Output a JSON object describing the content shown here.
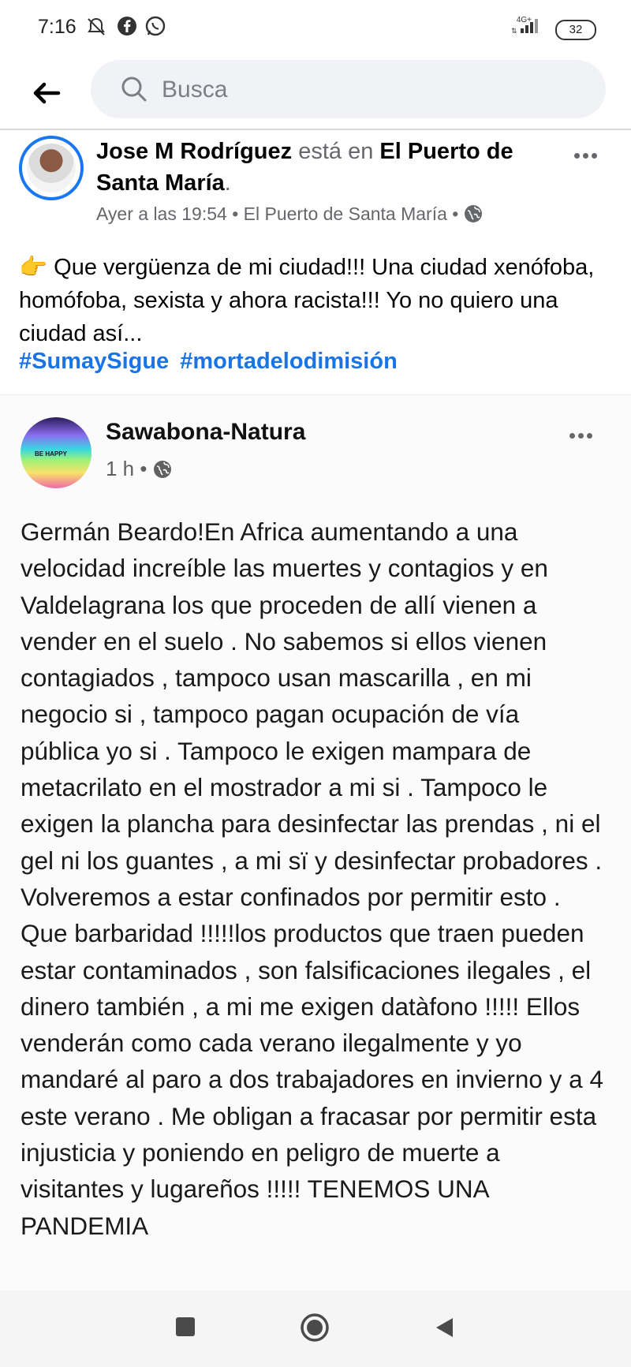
{
  "status_bar": {
    "time": "7:16",
    "network": "4G+",
    "battery": "32",
    "icons": [
      "notifications-off-icon",
      "facebook-icon",
      "whatsapp-icon"
    ]
  },
  "search": {
    "placeholder": "Busca"
  },
  "post": {
    "author": "Jose M Rodríguez",
    "connector": "está en",
    "place": "El Puerto de Santa María",
    "period": ".",
    "timestamp": "Ayer a las 19:54",
    "location": "El Puerto de Santa María",
    "privacy": "public-globe-icon",
    "emoji": "👉",
    "text": "Que vergüenza de mi ciudad!!! Una ciudad xenófoba, homófoba, sexista y ahora racista!!! Yo no quiero una ciudad así...",
    "hashtags": [
      "#SumaySigue",
      "#mortadelodimisión"
    ]
  },
  "shared_post": {
    "author": "Sawabona-Natura",
    "avatar_text": "BE HAPPY",
    "time": "1 h",
    "body": "Germán Beardo!En Africa aumentando a una velocidad increíble las muertes y contagios y en Valdelagrana los que proceden de allí vienen a vender en el suelo . No sabemos si ellos vienen contagiados , tampoco usan mascarilla , en mi negocio si , tampoco pagan ocupación de vía pública yo si . Tampoco le exigen mampara de metacrilato en el mostrador a mi si . Tampoco le exigen la plancha para desinfectar las prendas , ni el gel ni los guantes , a mi sï y desinfectar probadores . Volveremos a estar confinados por permitir esto . Que barbaridad !!!!!los productos que traen pueden estar contaminados , son falsificaciones ilegales , el dinero también , a mi me exigen datàfono !!!!! Ellos venderán como cada verano ilegalmente y yo mandaré al paro a dos trabajadores en invierno y a 4 este verano . Me obligan a fracasar por permitir esta injusticia y poniendo en peligro de muerte a visitantes y lugareños !!!!! TENEMOS UNA PANDEMIA"
  },
  "colors": {
    "accent": "#1877f2",
    "hashtag": "#1b74e4",
    "meta": "#65676b"
  }
}
